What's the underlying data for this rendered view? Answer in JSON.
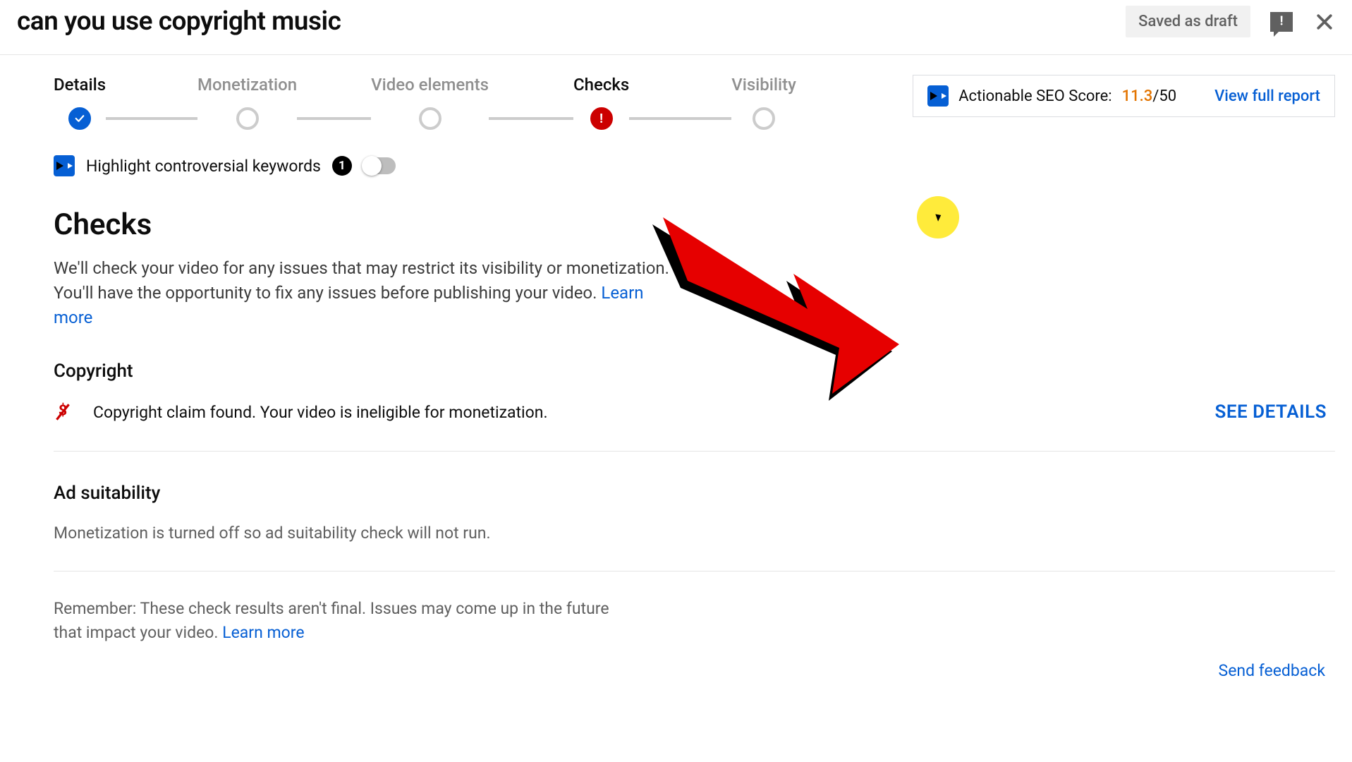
{
  "header": {
    "title": "can you use copyright music",
    "draft_badge": "Saved as draft"
  },
  "stepper": [
    {
      "label": "Details",
      "state": "done"
    },
    {
      "label": "Monetization",
      "state": "idle"
    },
    {
      "label": "Video elements",
      "state": "idle"
    },
    {
      "label": "Checks",
      "state": "error"
    },
    {
      "label": "Visibility",
      "state": "idle"
    }
  ],
  "seo": {
    "label": "Actionable SEO Score:",
    "score": "11.3",
    "max": "/50",
    "link": "View full report"
  },
  "keywords": {
    "label": "Highlight controversial keywords",
    "count": "1"
  },
  "checks": {
    "title": "Checks",
    "description": "We'll check your video for any issues that may restrict its visibility or monetization. You'll have the opportunity to fix any issues before publishing your video. ",
    "learn_more": "Learn more",
    "copyright": {
      "title": "Copyright",
      "message": "Copyright claim found. Your video is ineligible for monetization.",
      "action": "SEE DETAILS"
    },
    "ad": {
      "title": "Ad suitability",
      "message": "Monetization is turned off so ad suitability check will not run."
    },
    "disclaimer": "Remember: These check results aren't final. Issues may come up in the future that impact your video. ",
    "disclaimer_link": "Learn more",
    "feedback": "Send feedback"
  }
}
